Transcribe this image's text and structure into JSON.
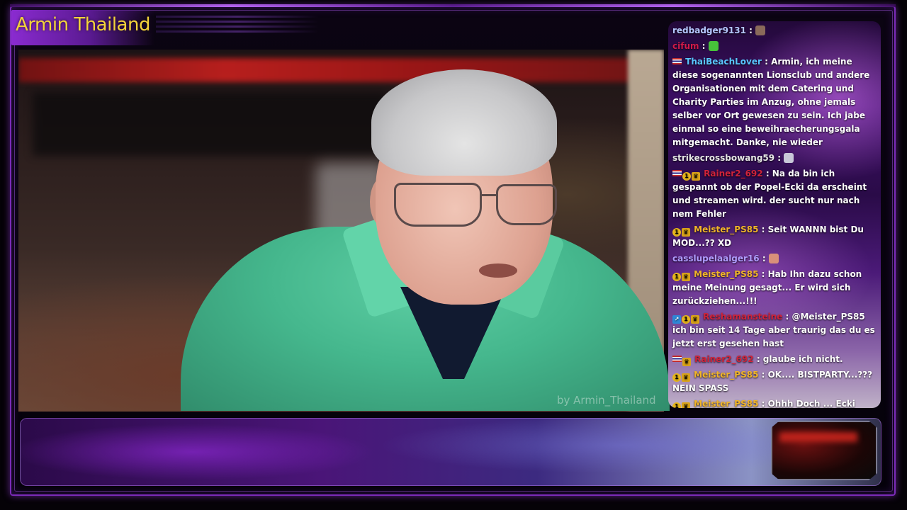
{
  "stream": {
    "title": "Armin Thailand",
    "watermark": "by Armin_Thailand"
  },
  "colors": {
    "frame": "#7b2bb8",
    "title_text": "#f2d23a",
    "shirt": "#45b78d"
  },
  "chat": {
    "messages": [
      {
        "user": "redbadger9131",
        "user_color": "#b6c8ff",
        "badges": [],
        "text": "",
        "emote": "#8a6a5a"
      },
      {
        "user": "cifum",
        "user_color": "#d11a4a",
        "badges": [],
        "text": "",
        "emote": "#47c23a"
      },
      {
        "user": "ThaiBeachLover",
        "user_color": "#59c6ff",
        "badges": [
          "flag"
        ],
        "text": "Armin, ich meine diese sogenannten Lionsclub und andere Organisationen mit dem Catering und Charity Parties im Anzug, ohne jemals selber vor Ort gewesen zu sein. Ich jabe einmal so eine beweihraecherungsgala mitgemacht. Danke, nie wieder",
        "emote": ""
      },
      {
        "user": "strikecrossbowang59",
        "user_color": "#e6e6e6",
        "badges": [],
        "text": "",
        "emote": "#c8c8d8"
      },
      {
        "user": "Rainer2_692",
        "user_color": "#d0233a",
        "badges": [
          "flag",
          "gold",
          "crown"
        ],
        "text": "Na da bin ich gespannt ob der Popel-Ecki da erscheint und streamen wird. der sucht nur nach nem Fehler",
        "emote": ""
      },
      {
        "user": "Meister_PS85",
        "user_color": "#f0b429",
        "badges": [
          "gold",
          "crown"
        ],
        "text": "Seit WANNN bist Du MOD...?? XD",
        "emote": ""
      },
      {
        "user": "casslupelaalger16",
        "user_color": "#b09cff",
        "badges": [],
        "text": "",
        "emote": "#d9907a"
      },
      {
        "user": "Meister_PS85",
        "user_color": "#f0b429",
        "badges": [
          "gold",
          "crown"
        ],
        "text": "Hab Ihn dazu schon meine Meinung gesagt... Er wird sich zurückziehen...!!!",
        "emote": ""
      },
      {
        "user": "Reshamansteine",
        "user_color": "#d0233a",
        "badges": [
          "blue",
          "gold",
          "crown"
        ],
        "text": "@Meister_PS85 ich bin seit 14 Tage aber traurig das du es jetzt erst gesehen hast",
        "emote": ""
      },
      {
        "user": "Rainer2_692",
        "user_color": "#d0233a",
        "badges": [
          "flag",
          "crown"
        ],
        "text": "glaube ich nicht.",
        "emote": ""
      },
      {
        "user": "Meister_PS85",
        "user_color": "#f0b429",
        "badges": [
          "gold",
          "crown"
        ],
        "text": "OK.... BISTPARTY...??? NEIN SPASS",
        "emote": ""
      },
      {
        "user": "Meister_PS85",
        "user_color": "#f0b429",
        "badges": [
          "gold",
          "crown"
        ],
        "text": "Ohhh Doch ... Ecki vertraut mir doch... bin doch der einzige \"Draht zum Grauhaarigen\"",
        "emote": ""
      }
    ]
  }
}
